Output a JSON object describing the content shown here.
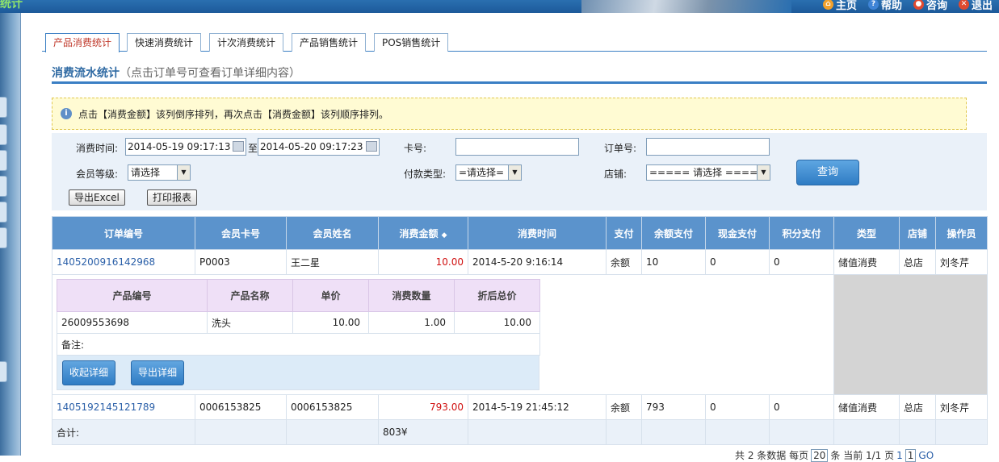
{
  "header": {
    "logo_text": "统计",
    "links": [
      {
        "label": "主页",
        "icon": "home-icon",
        "color": "#f2a02b"
      },
      {
        "label": "帮助",
        "icon": "help-icon",
        "color": "#3f84d6"
      },
      {
        "label": "咨询",
        "icon": "chat-icon",
        "color": "#e0492f"
      },
      {
        "label": "退出",
        "icon": "close-icon",
        "color": "#e0492f"
      }
    ]
  },
  "tabs": [
    {
      "label": "产品消费统计",
      "active": true
    },
    {
      "label": "快速消费统计"
    },
    {
      "label": "计次消费统计"
    },
    {
      "label": "产品销售统计"
    },
    {
      "label": "POS销售统计"
    }
  ],
  "section": {
    "title": "消费流水统计",
    "subtitle": "（点击订单号可查看订单详细内容）"
  },
  "notice": "点击【消费金额】该列倒序排列，再次点击【消费金额】该列顺序排列。",
  "filters": {
    "time_label": "消费时间:",
    "time_from": "2014-05-19 09:17:13",
    "time_to_sep": "至",
    "time_to": "2014-05-20 09:17:23",
    "card_label": "卡号:",
    "card_value": "",
    "order_label": "订单号:",
    "order_value": "",
    "level_label": "会员等级:",
    "level_value": "请选择",
    "pay_label": "付款类型:",
    "pay_value": "=请选择=",
    "shop_label": "店铺:",
    "shop_value": "===== 请选择 =====",
    "query_label": "查询",
    "export_label": "导出Excel",
    "print_label": "打印报表"
  },
  "table": {
    "columns": [
      "订单编号",
      "会员卡号",
      "会员姓名",
      "消费金额",
      "消费时间",
      "支付",
      "余额支付",
      "现金支付",
      "积分支付",
      "类型",
      "店铺",
      "操作员"
    ],
    "sort_indicator": "▲▼",
    "rows": [
      {
        "order_no": "1405200916142968",
        "card": "P0003",
        "name": "王二星",
        "amount": "10.00",
        "time": "2014-5-20 9:16:14",
        "pay": "余额",
        "balance": "10",
        "cash": "0",
        "points": "0",
        "type": "储值消费",
        "shop": "总店",
        "operator": "刘冬芹"
      },
      {
        "order_no": "1405192145121789",
        "card": "0006153825",
        "name": "0006153825",
        "amount": "793.00",
        "time": "2014-5-19 21:45:12",
        "pay": "余额",
        "balance": "793",
        "cash": "0",
        "points": "0",
        "type": "储值消费",
        "shop": "总店",
        "operator": "刘冬芹"
      }
    ],
    "total_label": "合计:",
    "total_amount": "803¥"
  },
  "detail": {
    "columns": [
      "产品编号",
      "产品名称",
      "单价",
      "消费数量",
      "折后总价"
    ],
    "row": {
      "code": "26009553698",
      "name": "洗头",
      "price": "10.00",
      "qty": "1.00",
      "total": "10.00"
    },
    "note_label": "备注:",
    "collapse_label": "收起详细",
    "export_label": "导出详细"
  },
  "pager": {
    "text1": "共 2 条数据 每页",
    "page_size": "20",
    "text2": "条 当前 1/1 页",
    "page_link": "1",
    "page_input": "1",
    "go": "GO"
  }
}
